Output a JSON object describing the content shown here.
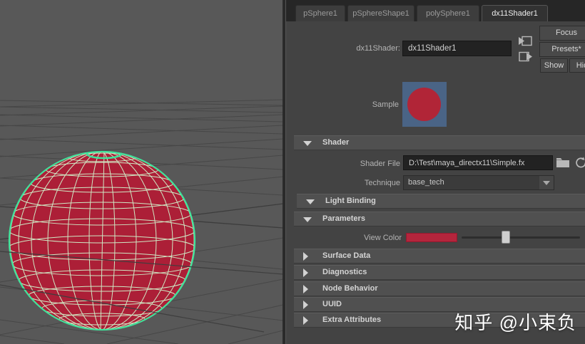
{
  "tabs": {
    "items": [
      {
        "label": "pSphere1"
      },
      {
        "label": "pSphereShape1"
      },
      {
        "label": "polySphere1"
      },
      {
        "label": "dx11Shader1"
      }
    ],
    "active": "dx11Shader1"
  },
  "node": {
    "type_label": "dx11Shader:",
    "name": "dx11Shader1"
  },
  "actions": {
    "focus": "Focus",
    "presets": "Presets*",
    "show": "Show",
    "hide": "Hide"
  },
  "sample": {
    "label": "Sample",
    "swatch_bg": "#4a6486",
    "swatch_dot": "#b12537"
  },
  "shader": {
    "file_label": "Shader File",
    "file_value": "D:\\Test\\maya_directx11\\Simple.fx",
    "technique_label": "Technique",
    "technique_value": "base_tech"
  },
  "parameters": {
    "view_color_label": "View Color",
    "view_color": "#b5253c",
    "slider_fraction": 0.34
  },
  "sections": [
    {
      "label": "Shader",
      "expanded": true
    },
    {
      "label": "Light Binding",
      "expanded": true
    },
    {
      "label": "Parameters",
      "expanded": true
    },
    {
      "label": "Surface Data",
      "expanded": false
    },
    {
      "label": "Diagnostics",
      "expanded": false
    },
    {
      "label": "Node Behavior",
      "expanded": false
    },
    {
      "label": "UUID",
      "expanded": false
    },
    {
      "label": "Extra Attributes",
      "expanded": false
    }
  ],
  "viewport": {
    "bg": "#585858",
    "grid_line": "#474747",
    "sphere_fill": "#ac1f37",
    "wireframe": "#cfe9c4",
    "selection_outline": "#3ee39b"
  },
  "watermark": "知乎 @小束负"
}
